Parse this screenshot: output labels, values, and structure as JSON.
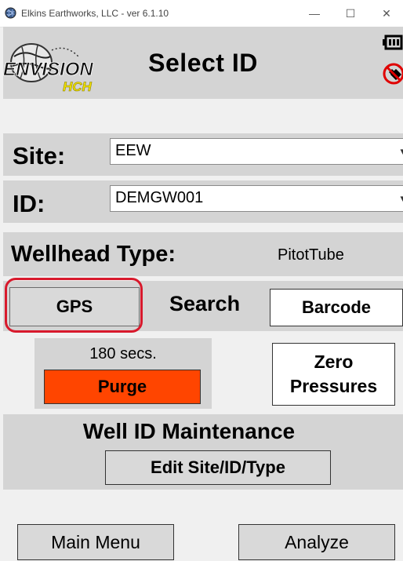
{
  "window": {
    "title": "Elkins Earthworks, LLC - ver 6.1.10",
    "minimize_glyph": "—",
    "maximize_glyph": "☐",
    "close_glyph": "✕"
  },
  "header": {
    "title": "Select ID",
    "logo_text": "ENVISION",
    "logo_subtext": "HCH",
    "status_icons": [
      "battery-icon",
      "gps-disabled-icon"
    ]
  },
  "site": {
    "label": "Site:",
    "value": "EEW"
  },
  "id_field": {
    "label": "ID:",
    "value": "DEMGW001"
  },
  "wellhead": {
    "label": "Wellhead Type:",
    "value": "PitotTube"
  },
  "search": {
    "label": "Search",
    "gps_button": "GPS",
    "barcode_button": "Barcode"
  },
  "purge": {
    "timer_text": "180 secs.",
    "button_label": "Purge",
    "button_color": "#ff4500"
  },
  "zero_pressures": {
    "line1": "Zero",
    "line2": "Pressures"
  },
  "maintenance": {
    "title": "Well ID Maintenance",
    "edit_button": "Edit Site/ID/Type"
  },
  "footer": {
    "main_menu_button": "Main Menu",
    "analyze_button": "Analyze"
  },
  "colors": {
    "panel_gray": "#d4d4d4",
    "highlight_red": "#d8192c",
    "logo_yellow": "#f2e200"
  }
}
